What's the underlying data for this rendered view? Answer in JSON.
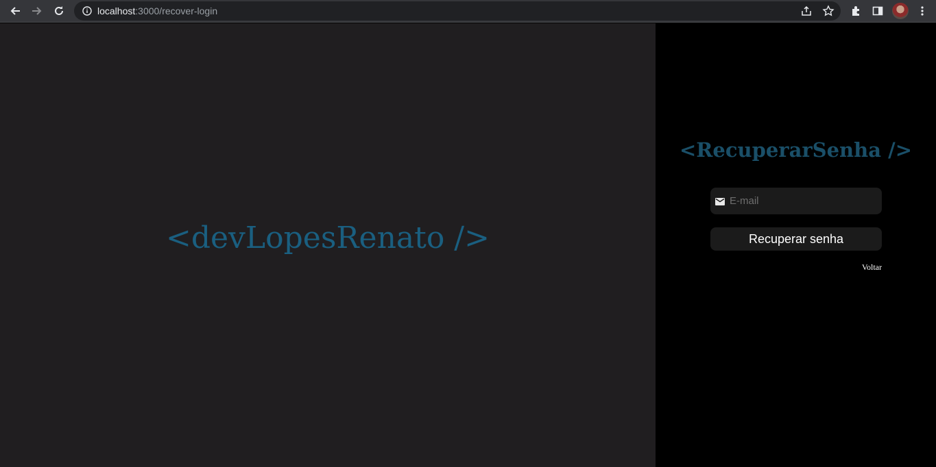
{
  "browser": {
    "url_host": "localhost",
    "url_path": ":3000/recover-login",
    "icons": [
      "back-icon",
      "forward-icon",
      "reload-icon",
      "info-icon",
      "share-icon",
      "star-icon",
      "extensions-icon",
      "side-panel-icon",
      "avatar",
      "menu-icon"
    ]
  },
  "left": {
    "brand": "<devLopesRenato />",
    "background": "#201e20",
    "brand_color": "#1a5f80"
  },
  "form": {
    "title": "<RecuperarSenha />",
    "email_placeholder": "E-mail",
    "email_value": "",
    "submit_label": "Recuperar senha",
    "back_label": "Voltar",
    "field_bg": "#1b1b1b",
    "title_color": "#1a4f68"
  }
}
